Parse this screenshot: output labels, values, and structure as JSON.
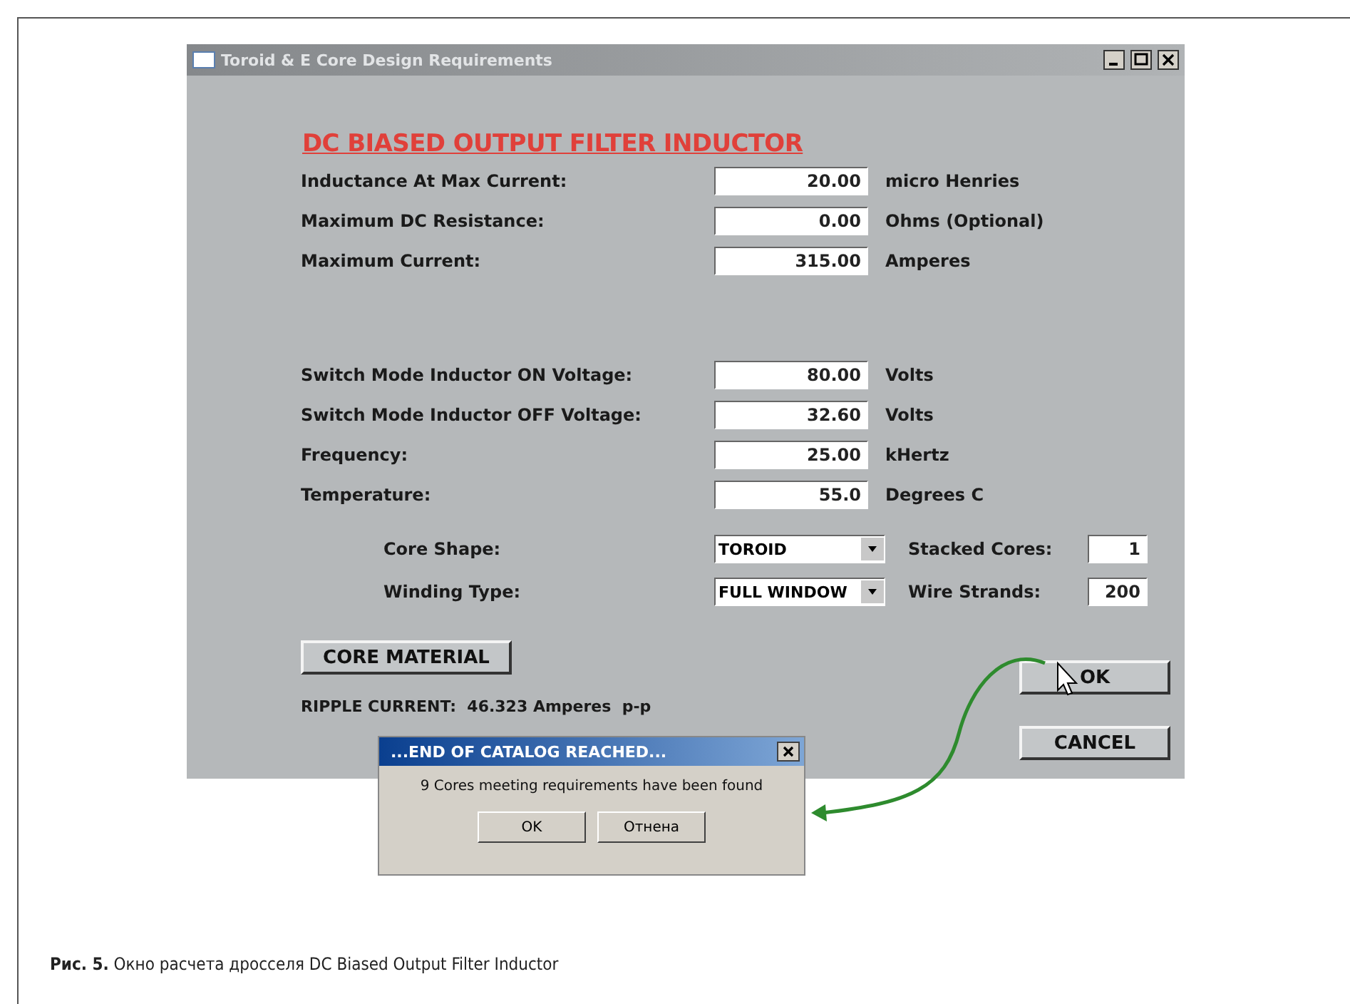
{
  "window": {
    "title": "Toroid & E Core Design Requirements"
  },
  "heading": "DC BIASED OUTPUT FILTER INDUCTOR",
  "field_groups": [
    [
      {
        "label": "Inductance At Max Current:",
        "value": "20.00",
        "unit": "micro Henries"
      },
      {
        "label": "Maximum DC Resistance:",
        "value": "0.00",
        "unit": "Ohms (Optional)"
      },
      {
        "label": "Maximum Current:",
        "value": "315.00",
        "unit": "Amperes"
      }
    ],
    [
      {
        "label": "Switch Mode Inductor ON Voltage:",
        "value": "80.00",
        "unit": "Volts"
      },
      {
        "label": "Switch Mode Inductor OFF Voltage:",
        "value": "32.60",
        "unit": "Volts"
      },
      {
        "label": "Frequency:",
        "value": "25.00",
        "unit": "kHertz"
      },
      {
        "label": "Temperature:",
        "value": "55.0",
        "unit": "Degrees C"
      }
    ]
  ],
  "selects": [
    {
      "label": "Core Shape:",
      "value": "TOROID",
      "side_label": "Stacked Cores:",
      "side_value": "1"
    },
    {
      "label": "Winding Type:",
      "value": "FULL WINDOW",
      "side_label": "Wire Strands:",
      "side_value": "200"
    }
  ],
  "core_material_button": "CORE MATERIAL",
  "ripple_current": "RIPPLE CURRENT:  46.323 Amperes  p-p",
  "ok_button": "OK",
  "cancel_button": "CANCEL",
  "dialog": {
    "title": "...END OF CATALOG REACHED...",
    "message": "9 Cores meeting requirements have been found",
    "buttons": [
      "OK",
      "Отнена"
    ]
  },
  "caption": "**Рис. 5.** Окно расчета дросселя DC Biased Output Filter Inductor"
}
